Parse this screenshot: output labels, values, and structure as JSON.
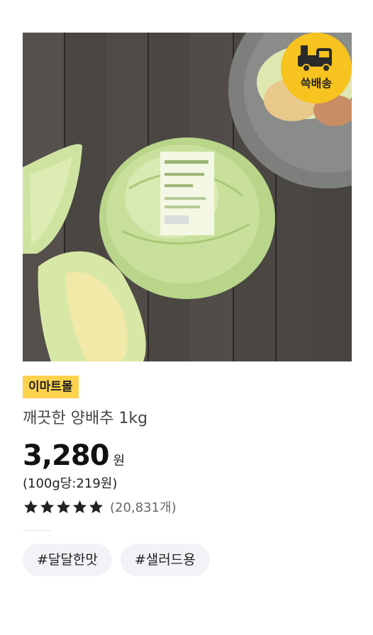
{
  "product": {
    "image_alt": "깨끗한 양배추 1kg",
    "badge": {
      "label": "쓱배송",
      "icon": "delivery-truck-icon",
      "color": "#f7c31e"
    },
    "seller_tag": "이마트몰",
    "title": "깨끗한 양배추 1kg",
    "price": "3,280",
    "currency": "원",
    "unit_price": "(100g당:219원)",
    "rating": {
      "stars": 5,
      "max": 5,
      "review_count": "(20,831개)"
    },
    "hashtags": [
      "#달달한맛",
      "#샐러드용"
    ]
  },
  "colors": {
    "accent_yellow": "#ffd24d",
    "badge_yellow": "#f7c31e",
    "chip_bg": "#f1f3f6"
  }
}
